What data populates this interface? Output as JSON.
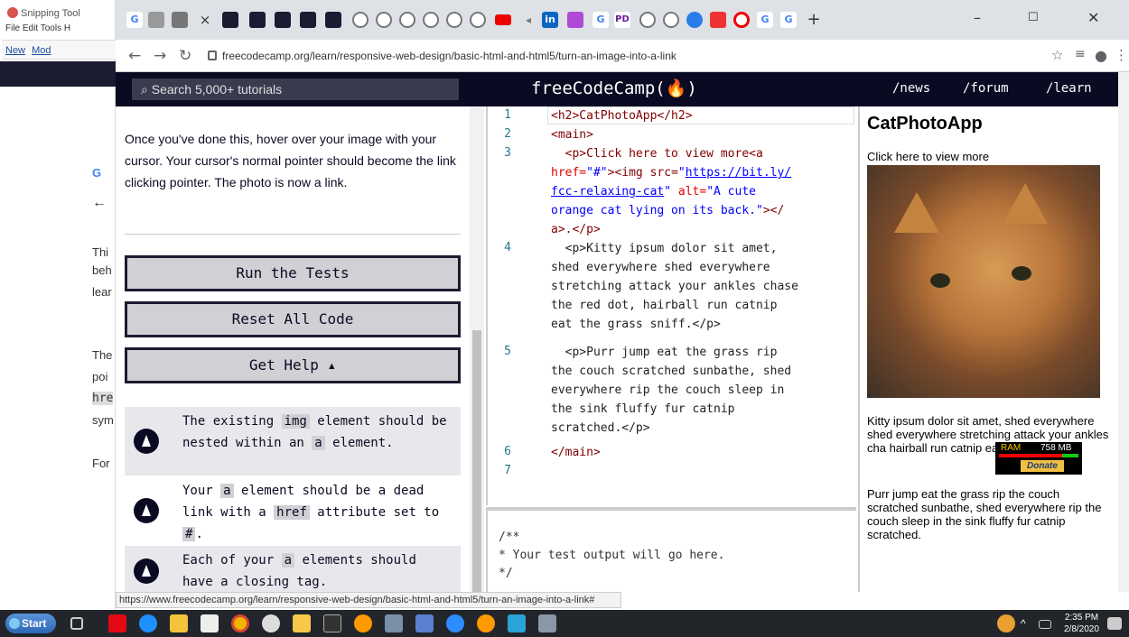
{
  "snipping_tool": {
    "title": "Snipping Tool",
    "menu": "File  Edit  Tools  H",
    "new_label": "New",
    "mode_label": "Mod"
  },
  "behind_lesson": {
    "g": "G",
    "back": "←",
    "t1": "Thi",
    "t2": "beh",
    "t3": "lear",
    "t4": "The",
    "t5": "poi",
    "t6": "hre",
    "t7": "sym",
    "t8": "For"
  },
  "browser": {
    "tab_close": "×",
    "new_tab": "+",
    "url": "freecodecamp.org/learn/responsive-web-design/basic-html-and-html5/turn-an-image-into-a-link",
    "status_url": "https://www.freecodecamp.org/learn/responsive-web-design/basic-html-and-html5/turn-an-image-into-a-link#"
  },
  "fcc_nav": {
    "search_placeholder": "Search 5,000+ tutorials",
    "logo": "freeCodeCamp(🔥)",
    "links": [
      "/news",
      "/forum",
      "/learn"
    ]
  },
  "lesson": {
    "text": "Once you've done this, hover over your image with your cursor. Your cursor's normal pointer should become the link clicking pointer. The photo is now a link.",
    "buttons": {
      "run": "Run the Tests",
      "reset": "Reset All Code",
      "help": "Get Help ▴"
    },
    "tests": [
      {
        "pre": "The existing ",
        "code1": "img",
        "mid": " element should be nested within an ",
        "code2": "a",
        "post": " element."
      },
      {
        "pre": "Your ",
        "code1": "a",
        "mid": " element should be a dead link with a ",
        "code2": "href",
        "post": " attribute set to ",
        "code3": "#",
        "end": "."
      },
      {
        "pre": "Each of your ",
        "code1": "a",
        "mid": " elements should have a closing tag.",
        "code2": "",
        "post": ""
      }
    ]
  },
  "editor": {
    "line_numbers": [
      "1",
      "2",
      "3",
      "4",
      "5",
      "6",
      "7"
    ],
    "code": {
      "l1": "<h2>CatPhotoApp</h2>",
      "l2": "<main>",
      "l3a": "  <p>Click here to view more<a",
      "l3b_attr": "href=",
      "l3b_val": "\"#\"",
      "l3b_tag": "><img src=",
      "l3b_q": "\"",
      "l3b_link": "https://bit.ly/",
      "l3c_link": "fcc-relaxing-cat",
      "l3c_q": "\"",
      "l3c_attr": " alt=",
      "l3c_val": "\"A cute",
      "l3d_val": "orange cat lying on its back.\"",
      "l3d_tag": "></",
      "l3e": "a>.</p>",
      "l4a": "  <p>Kitty ipsum dolor sit amet,",
      "l4b": "shed everywhere shed everywhere",
      "l4c": "stretching attack your ankles chase",
      "l4d": "the red dot, hairball run catnip",
      "l4e": "eat the grass sniff.</p>",
      "l5a": "  <p>Purr jump eat the grass rip",
      "l5b": "the couch scratched sunbathe, shed",
      "l5c": "everywhere rip the couch sleep in",
      "l5d": "the sink fluffy fur catnip",
      "l5e": "scratched.</p>",
      "l6": "</main>"
    },
    "console": "/**\n* Your test output will go here.\n*/"
  },
  "preview": {
    "title": "CatPhotoApp",
    "click_text": "Click here to view more",
    "p1": "Kitty ipsum dolor sit amet, shed everywhere shed everywhere stretching attack your ankles cha hairball run catnip eat",
    "p2": "Purr jump eat the grass rip the couch scratched sunbathe, shed everywhere rip the couch sleep in the sink fluffy fur catnip scratched.",
    "ram_label": "RAM",
    "ram_value": "758 MB",
    "donate": "Donate"
  },
  "taskbar": {
    "start": "Start",
    "time": "2:35 PM",
    "date": "2/8/2020"
  },
  "colors": {
    "fcc_dark": "#0a0a23",
    "fcc_button": "#d0d0d5",
    "code_tag": "#800000",
    "code_attr": "#e50000",
    "code_value": "#0000ff"
  }
}
